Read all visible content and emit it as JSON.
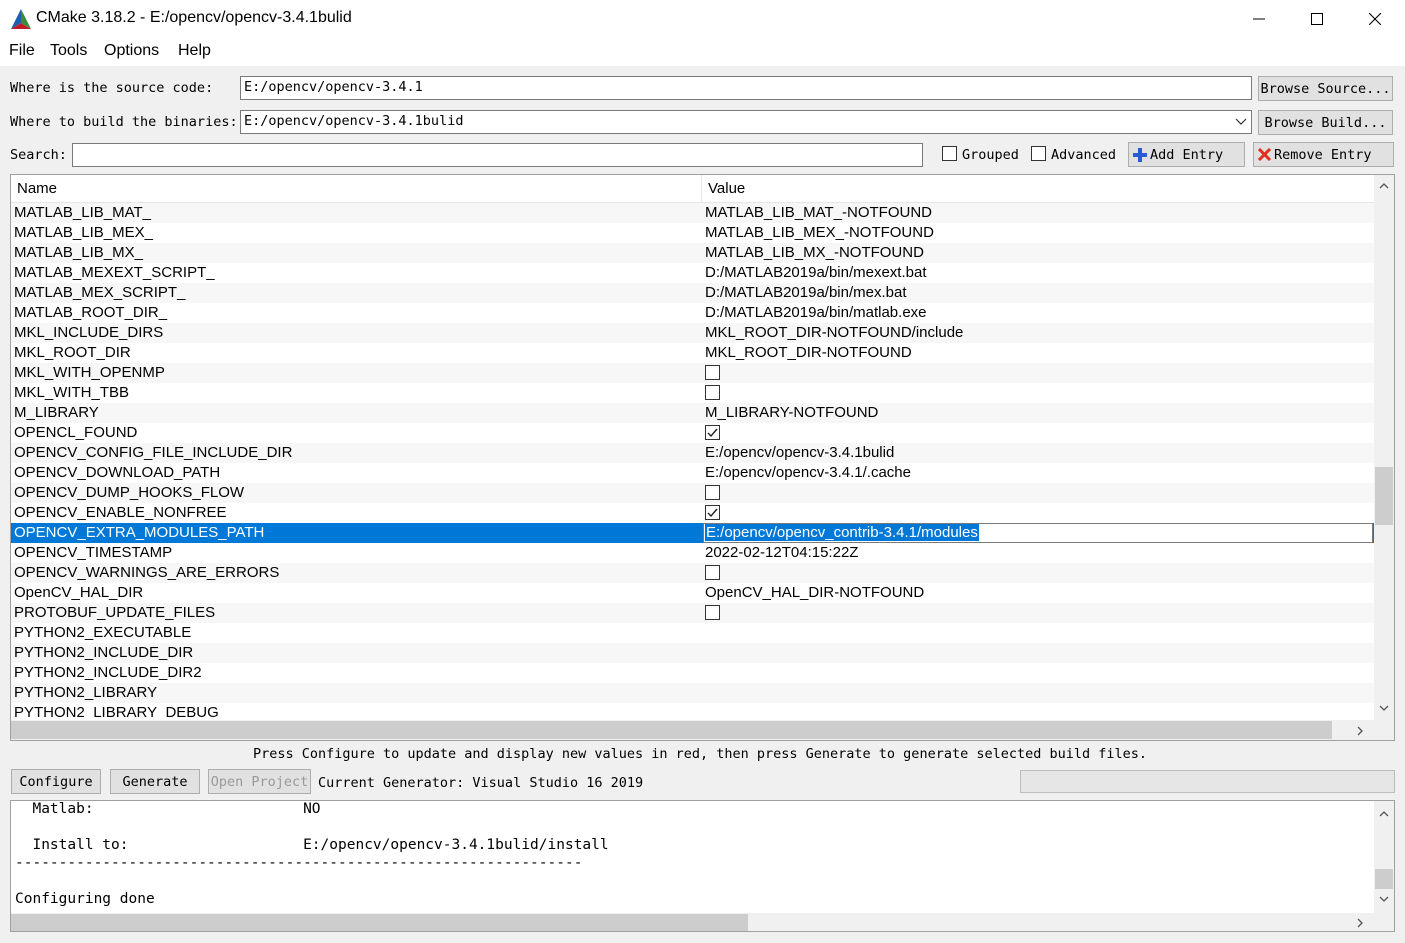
{
  "window": {
    "title": "CMake 3.18.2 - E:/opencv/opencv-3.4.1bulid"
  },
  "menu": [
    "File",
    "Tools",
    "Options",
    "Help"
  ],
  "source": {
    "label": "Where is the source code:",
    "value": "E:/opencv/opencv-3.4.1",
    "button": "Browse Source..."
  },
  "binaries": {
    "label": "Where to build the binaries:",
    "value": "E:/opencv/opencv-3.4.1bulid",
    "button": "Browse Build..."
  },
  "search": {
    "label": "Search:",
    "value": "",
    "grouped_label": "Grouped",
    "grouped_checked": false,
    "advanced_label": "Advanced",
    "advanced_checked": false,
    "add_entry": "Add Entry",
    "remove_entry": "Remove Entry"
  },
  "table": {
    "columns": [
      "Name",
      "Value"
    ],
    "rows": [
      {
        "name": "MATLAB_LIB_MAT_",
        "value": "MATLAB_LIB_MAT_-NOTFOUND"
      },
      {
        "name": "MATLAB_LIB_MEX_",
        "value": "MATLAB_LIB_MEX_-NOTFOUND"
      },
      {
        "name": "MATLAB_LIB_MX_",
        "value": "MATLAB_LIB_MX_-NOTFOUND"
      },
      {
        "name": "MATLAB_MEXEXT_SCRIPT_",
        "value": "D:/MATLAB2019a/bin/mexext.bat"
      },
      {
        "name": "MATLAB_MEX_SCRIPT_",
        "value": "D:/MATLAB2019a/bin/mex.bat"
      },
      {
        "name": "MATLAB_ROOT_DIR_",
        "value": "D:/MATLAB2019a/bin/matlab.exe"
      },
      {
        "name": "MKL_INCLUDE_DIRS",
        "value": "MKL_ROOT_DIR-NOTFOUND/include"
      },
      {
        "name": "MKL_ROOT_DIR",
        "value": "MKL_ROOT_DIR-NOTFOUND"
      },
      {
        "name": "MKL_WITH_OPENMP",
        "checkbox": true,
        "checked": false
      },
      {
        "name": "MKL_WITH_TBB",
        "checkbox": true,
        "checked": false
      },
      {
        "name": "M_LIBRARY",
        "value": "M_LIBRARY-NOTFOUND"
      },
      {
        "name": "OPENCL_FOUND",
        "checkbox": true,
        "checked": true
      },
      {
        "name": "OPENCV_CONFIG_FILE_INCLUDE_DIR",
        "value": "E:/opencv/opencv-3.4.1bulid"
      },
      {
        "name": "OPENCV_DOWNLOAD_PATH",
        "value": "E:/opencv/opencv-3.4.1/.cache"
      },
      {
        "name": "OPENCV_DUMP_HOOKS_FLOW",
        "checkbox": true,
        "checked": false
      },
      {
        "name": "OPENCV_ENABLE_NONFREE",
        "checkbox": true,
        "checked": true
      },
      {
        "name": "OPENCV_EXTRA_MODULES_PATH",
        "value": "E:/opencv/opencv_contrib-3.4.1/modules",
        "selected": true,
        "editing": true
      },
      {
        "name": "OPENCV_TIMESTAMP",
        "value": "2022-02-12T04:15:22Z"
      },
      {
        "name": "OPENCV_WARNINGS_ARE_ERRORS",
        "checkbox": true,
        "checked": false
      },
      {
        "name": "OpenCV_HAL_DIR",
        "value": "OpenCV_HAL_DIR-NOTFOUND"
      },
      {
        "name": "PROTOBUF_UPDATE_FILES",
        "checkbox": true,
        "checked": false
      },
      {
        "name": "PYTHON2_EXECUTABLE",
        "value": ""
      },
      {
        "name": "PYTHON2_INCLUDE_DIR",
        "value": ""
      },
      {
        "name": "PYTHON2_INCLUDE_DIR2",
        "value": ""
      },
      {
        "name": "PYTHON2_LIBRARY",
        "value": ""
      },
      {
        "name": "PYTHON2_LIBRARY_DEBUG",
        "value": ""
      }
    ]
  },
  "hint": "Press Configure to update and display new values in red, then press Generate to generate selected build files.",
  "actions": {
    "configure": "Configure",
    "generate": "Generate",
    "open_project": "Open Project",
    "generator": "Current Generator: Visual Studio 16 2019"
  },
  "output": {
    "lines": [
      "  Matlab:                        NO",
      "",
      "  Install to:                    E:/opencv/opencv-3.4.1bulid/install",
      "-----------------------------------------------------------------",
      "",
      "Configuring done"
    ]
  },
  "colors": {
    "selection": "#0078d7",
    "window_bg": "#f0f0f0"
  }
}
